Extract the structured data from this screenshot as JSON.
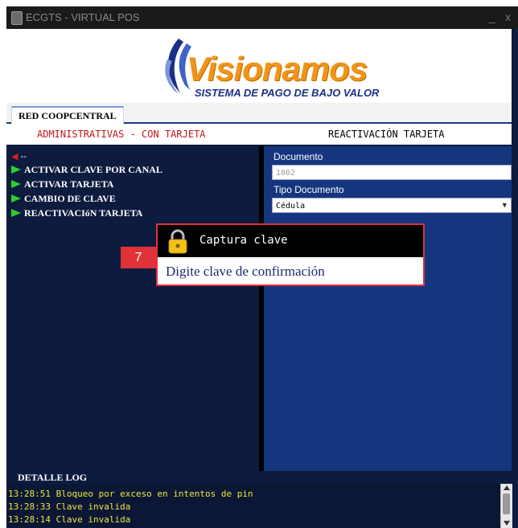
{
  "window": {
    "title": "ECGTS - VIRTUAL POS",
    "minimize_glyph": "_",
    "close_glyph": "x"
  },
  "banner": {
    "logo_text": "Visionamos",
    "tagline": "SISTEMA DE PAGO DE BAJO VALOR",
    "brand_orange": "#f29418",
    "brand_blue": "#1b2f86"
  },
  "tabs": [
    {
      "label": "RED COOPCENTRAL"
    }
  ],
  "header": {
    "left_title": "ADMINISTRATIVAS - CON TARJETA",
    "right_title": "REACTIVACIÓN TARJETA"
  },
  "menu": {
    "back_label": "--",
    "items": [
      {
        "label": "ACTIVAR CLAVE POR CANAL"
      },
      {
        "label": "ACTIVAR TARJETA"
      },
      {
        "label": "CAMBIO DE CLAVE"
      },
      {
        "label": "REACTIVACIóN TARJETA"
      }
    ]
  },
  "form": {
    "documento_label": "Documento",
    "documento_value": "1002",
    "tipo_label": "Tipo Documento",
    "tipo_value": "Cédula"
  },
  "dialog": {
    "title": "Captura clave",
    "message": "Digite clave de confirmación",
    "icon": "lock-icon"
  },
  "step_badge": {
    "number": "7"
  },
  "log": {
    "header": "DETALLE LOG",
    "lines": [
      "13:28:51 Bloqueo por exceso en intentos de pin",
      "13:28:33 Clave invalida",
      "13:28:14 Clave invalida"
    ]
  },
  "colors": {
    "panel_dark": "#0d1b3e",
    "panel_blue": "#15367f",
    "log_text": "#f0e442",
    "highlight_red": "#e1323a",
    "menu_flag": "#2bd12b"
  }
}
